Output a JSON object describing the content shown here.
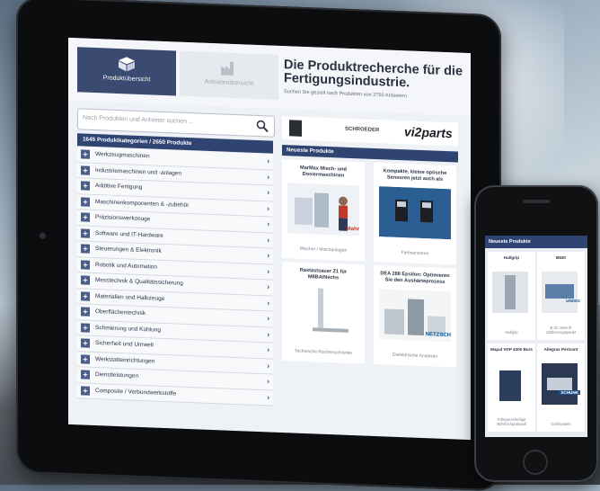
{
  "tablet": {
    "tabs": [
      {
        "label": "Produktübersicht"
      },
      {
        "label": "Anbieterübersicht"
      }
    ],
    "headline": "Die Produktrecherche für die Fertigungsindustrie.",
    "subline": "Suchen Sie gezielt nach Produkten von 2750 Anbietern",
    "search_placeholder": "Nach Produkten und Anbieter suchen ...",
    "categories_header": "1645 Produktkategorien / 2650 Produkte",
    "categories": [
      "Werkzeugmaschinen",
      "Industriemaschinen und -anlagen",
      "Additive Fertigung",
      "Maschinenkomponenten & -zubehör",
      "Präzisionswerkzeuge",
      "Software und IT-Hardware",
      "Steuerungen & Elektronik",
      "Robotik und Automation",
      "Messtechnik & Qualitätssicherung",
      "Materialien und Halbzeuge",
      "Oberflächentechnik",
      "Schmierung und Kühlung",
      "Sicherheit und Umwelt",
      "Werkstatteinrichtungen",
      "Dienstleistungen",
      "Composite / Verbundwerkstoffe"
    ],
    "logos": {
      "schroeder": "SCHROEDER",
      "v2parts": "vi2parts"
    },
    "new_products_header": "Neueste Produkte",
    "products": [
      {
        "title": "MarMax Misch- und Dosiermaschinen",
        "caption": "Mischer / Mischanlagen",
        "brand": "Mahr"
      },
      {
        "title": "Kompakte, kleine optische Sensoren jetzt auch als",
        "caption": "Farbsensoren"
      },
      {
        "title": "Rastastsauer Z1 für M8BA/Nechs",
        "caption": "Technische Rechenschränke"
      },
      {
        "title": "DEA 288 Epsilon: Optimieren Sie den Aushärteprozess",
        "caption": "Dielektrische Analysen",
        "brand": "NETZSCH"
      }
    ]
  },
  "phone": {
    "header": "Neueste Produkte",
    "cells": [
      {
        "title": "Hallgrip",
        "caption": "Hallgrip"
      },
      {
        "title": "B830",
        "caption": "B Zu unter fit Zahleinzogspunkt",
        "brand": "UNISIG"
      },
      {
        "title": "Mapal VDP 4300 Burs",
        "caption": "Fahrgerecht/digit Bohrlochgrabwall"
      },
      {
        "title": "Allegras Pericont",
        "caption": "Greifsystem",
        "brand": "SCHUNK"
      }
    ]
  },
  "colors": {
    "navy": "#2f4470",
    "tab_active": "#3a4a70"
  }
}
